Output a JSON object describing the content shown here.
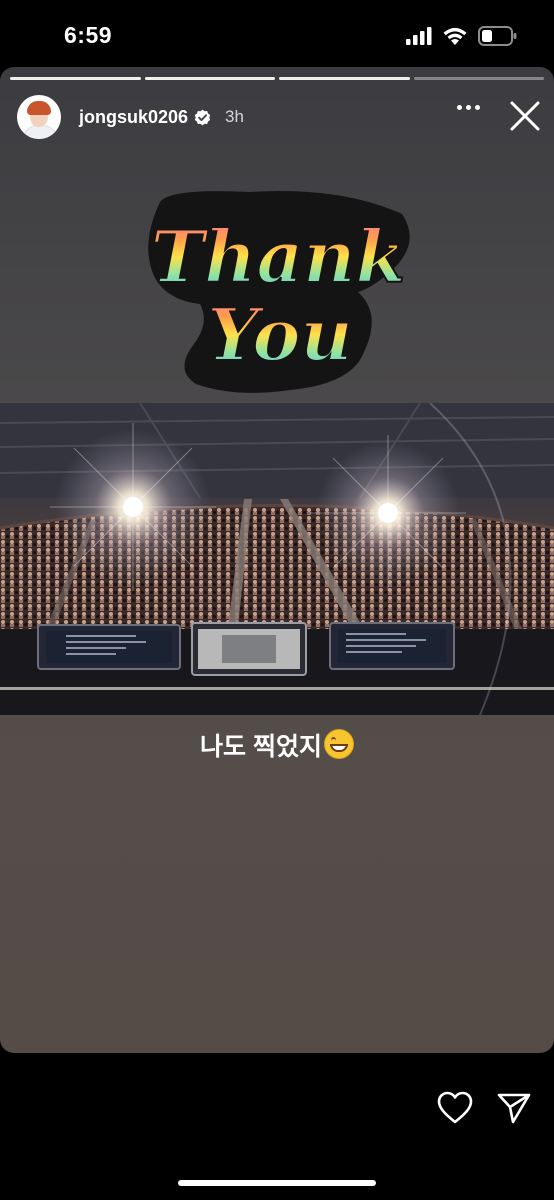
{
  "status_bar": {
    "time": "6:59",
    "icons": [
      "cellular-signal-icon",
      "wifi-icon",
      "battery-icon"
    ]
  },
  "story": {
    "progress": {
      "segments": 4,
      "completed": 3
    },
    "user": {
      "username": "jongsuk0206",
      "verified": true,
      "time_ago": "3h"
    },
    "sticker": {
      "text_line1": "Thank",
      "text_line2": "You"
    },
    "caption": "나도 찍었지",
    "caption_emoji": "grinning-face-icon"
  },
  "footer": {
    "icons": [
      "heart-icon",
      "send-icon"
    ]
  },
  "colors": {
    "background": "#000000",
    "story_top": "#3c3c40",
    "story_bottom": "#554c47",
    "sticker_gradient": [
      "#ff6fa1",
      "#ffa04a",
      "#ffe14a",
      "#8fe3a3",
      "#5ab4ef"
    ]
  }
}
